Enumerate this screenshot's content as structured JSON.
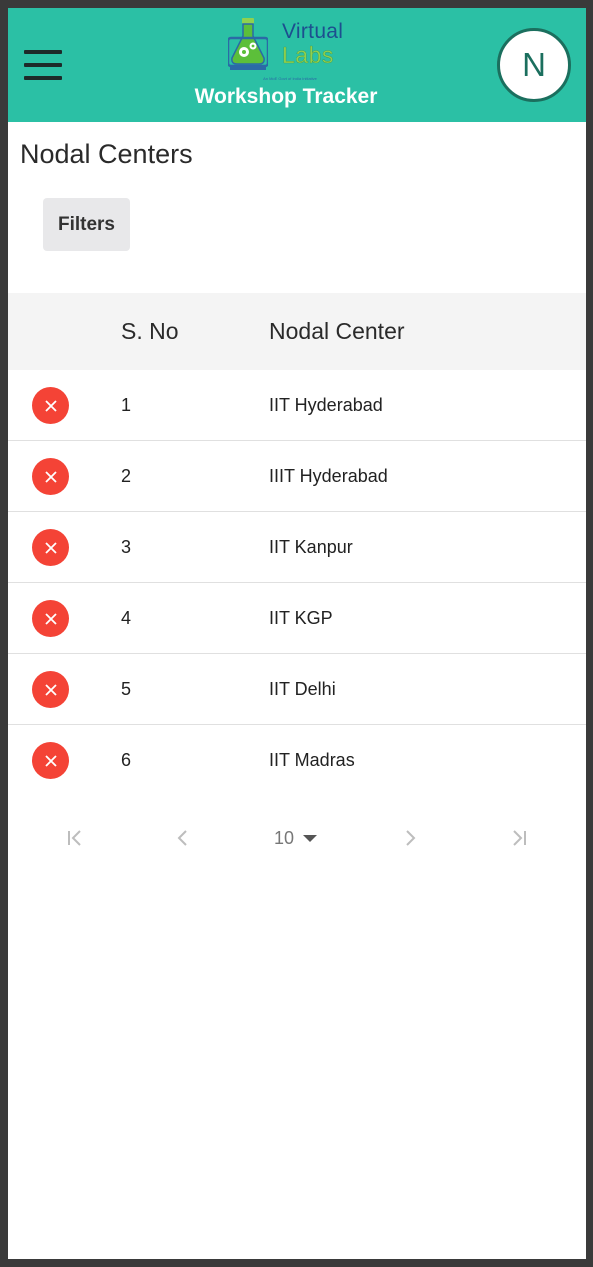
{
  "header": {
    "app_title": "Workshop Tracker",
    "logo_line1": "Virtual",
    "logo_line2": "Labs",
    "logo_tagline": "An MoE Govt of India Initiative",
    "avatar_initial": "N",
    "brand_color": "#2bc0a5"
  },
  "page": {
    "title": "Nodal Centers",
    "filters_label": "Filters"
  },
  "table": {
    "columns": [
      "S. No",
      "Nodal Center"
    ],
    "rows": [
      {
        "sno": "1",
        "name": "IIT Hyderabad"
      },
      {
        "sno": "2",
        "name": "IIIT Hyderabad"
      },
      {
        "sno": "3",
        "name": "IIT Kanpur"
      },
      {
        "sno": "4",
        "name": "IIT KGP"
      },
      {
        "sno": "5",
        "name": "IIT Delhi"
      },
      {
        "sno": "6",
        "name": "IIT Madras"
      }
    ]
  },
  "pagination": {
    "page_size": "10",
    "icons": [
      "first-page-icon",
      "prev-page-icon",
      "next-page-icon",
      "last-page-icon"
    ]
  }
}
